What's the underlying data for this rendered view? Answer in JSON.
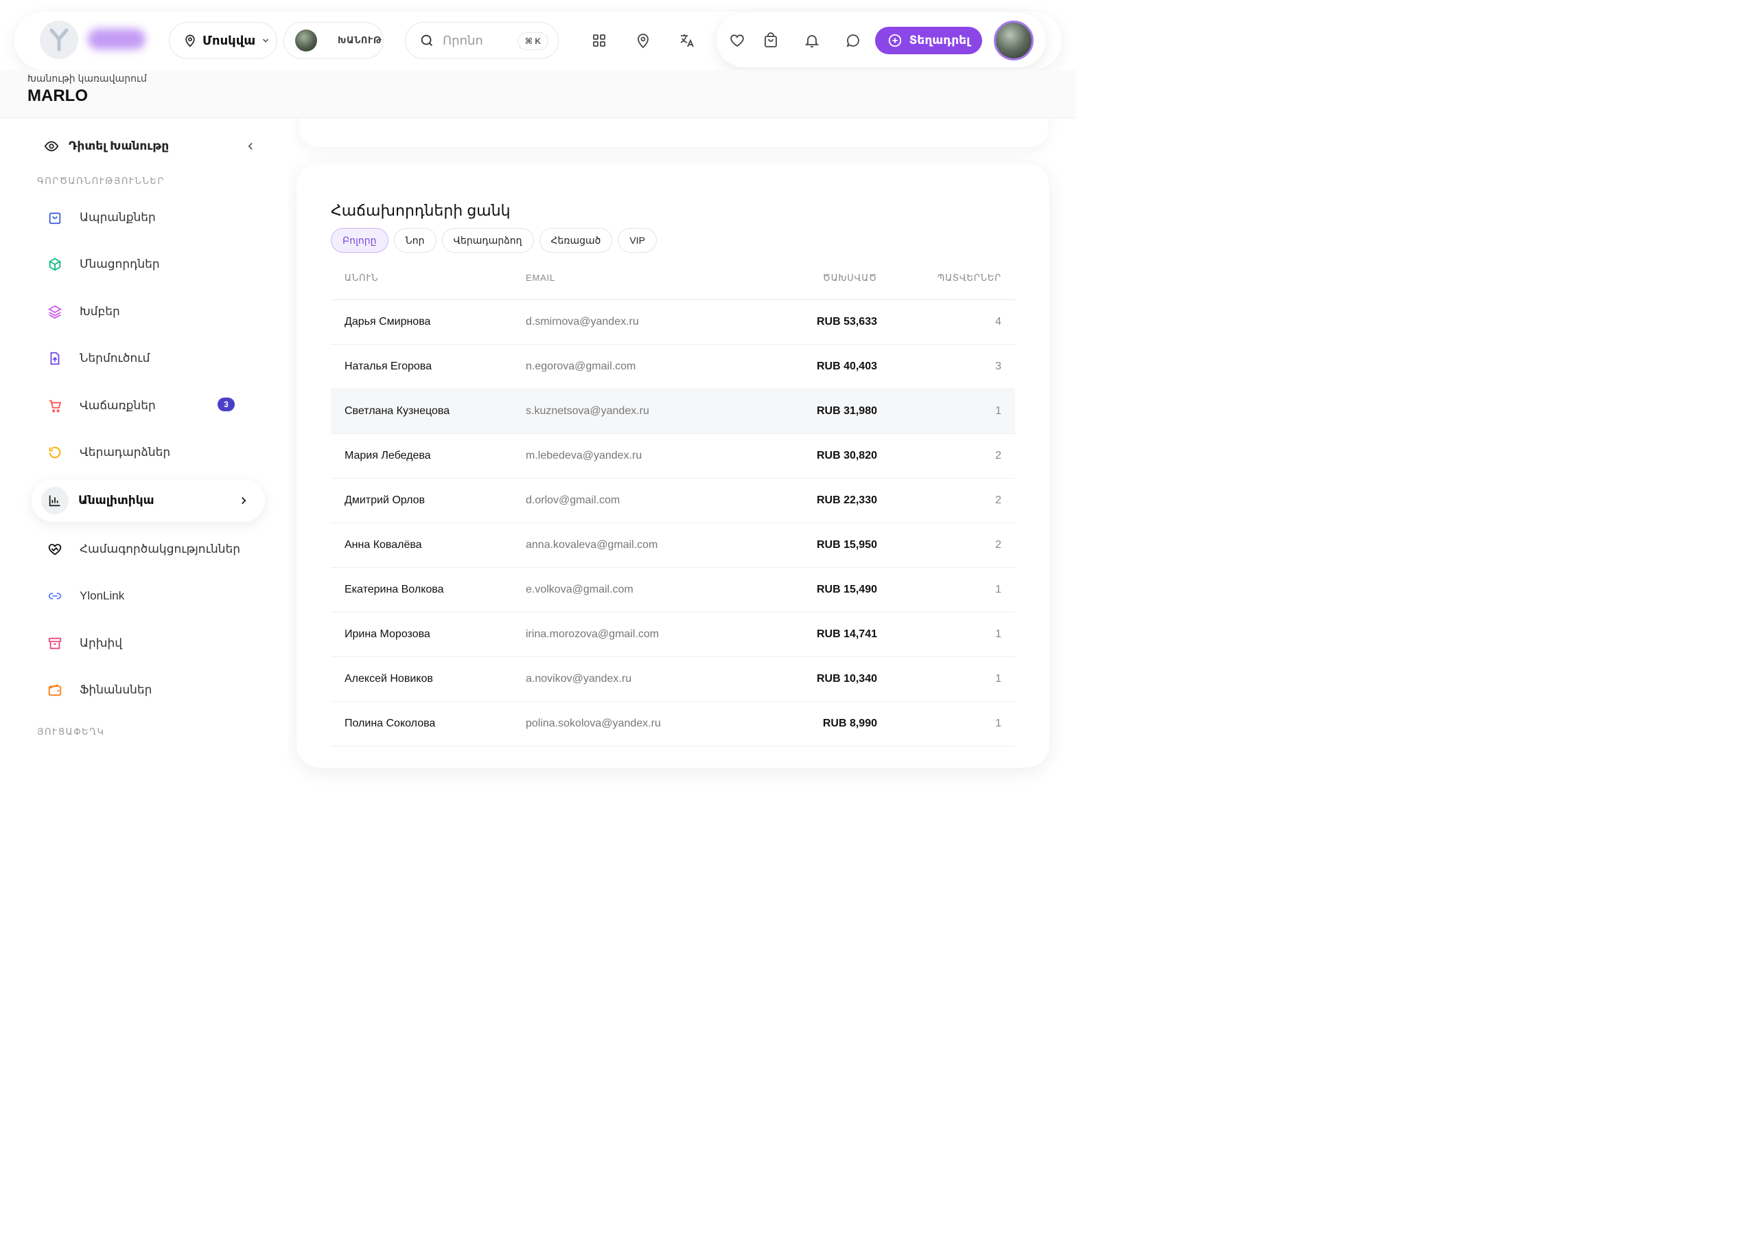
{
  "header": {
    "city": "Մոսկվա",
    "store_name": "ԽԱՆՈՒԹ",
    "search_placeholder": "Որոնո",
    "search_shortcut": "⌘ K",
    "post_button": "Տեղադրել"
  },
  "store": {
    "subtitle": "Խանութի կառավարում",
    "name": "MARLO"
  },
  "sidebar": {
    "view_store": "Դիտել Խանութը",
    "section_operations": "ԳՈՐԾԱՌՆՈՒԹՅՈՒՆՆԵՐ",
    "section_profile": "ՅՈՒՑԱՓԵՂԿ",
    "items": [
      {
        "label": "Ապրանքներ",
        "icon": "bag-icon",
        "color": "#3b5bdb"
      },
      {
        "label": "Մնացորդներ",
        "icon": "box-icon",
        "color": "#12b886"
      },
      {
        "label": "Խմբեր",
        "icon": "layers-icon",
        "color": "#cc5de8"
      },
      {
        "label": "Ներմուծում",
        "icon": "file-upload-icon",
        "color": "#7048e8"
      },
      {
        "label": "Վաճառքներ",
        "icon": "cart-icon",
        "color": "#fa5252",
        "badge": "3"
      },
      {
        "label": "Վերադարձներ",
        "icon": "refresh-icon",
        "color": "#fab005"
      },
      {
        "label": "Անալիտիկա",
        "icon": "chart-icon",
        "color": "#222222",
        "active": true
      },
      {
        "label": "Համագործակցություններ",
        "icon": "handshake-icon",
        "color": "#111111"
      },
      {
        "label": "YlonLink",
        "icon": "link-icon",
        "color": "#5c7cfa"
      },
      {
        "label": "Արխիվ",
        "icon": "archive-icon",
        "color": "#e64980"
      },
      {
        "label": "Ֆինանսներ",
        "icon": "wallet-icon",
        "color": "#fd7e14"
      }
    ]
  },
  "customers": {
    "title": "Հաճախորդների ցանկ",
    "filters": [
      "Բոլորը",
      "Նոր",
      "Վերադարձող",
      "Հեռացած",
      "VIP"
    ],
    "columns": [
      "ԱՆՈՒՆ",
      "EMAIL",
      "ԾԱԽՍՎԱԾ",
      "ՊԱՏՎԵՐՆԵՐ"
    ],
    "rows": [
      {
        "name": "Дарья Смирнова",
        "email": "d.smirnova@yandex.ru",
        "spent": "RUB 53,633",
        "orders": "4"
      },
      {
        "name": "Наталья Егорова",
        "email": "n.egorova@gmail.com",
        "spent": "RUB 40,403",
        "orders": "3"
      },
      {
        "name": "Светлана Кузнецова",
        "email": "s.kuznetsova@yandex.ru",
        "spent": "RUB 31,980",
        "orders": "1"
      },
      {
        "name": "Мария Лебедева",
        "email": "m.lebedeva@yandex.ru",
        "spent": "RUB 30,820",
        "orders": "2"
      },
      {
        "name": "Дмитрий Орлов",
        "email": "d.orlov@gmail.com",
        "spent": "RUB 22,330",
        "orders": "2"
      },
      {
        "name": "Анна Ковалёва",
        "email": "anna.kovaleva@gmail.com",
        "spent": "RUB 15,950",
        "orders": "2"
      },
      {
        "name": "Екатерина Волкова",
        "email": "e.volkova@gmail.com",
        "spent": "RUB 15,490",
        "orders": "1"
      },
      {
        "name": "Ирина Морозова",
        "email": "irina.morozova@gmail.com",
        "spent": "RUB 14,741",
        "orders": "1"
      },
      {
        "name": "Алексей Новиков",
        "email": "a.novikov@yandex.ru",
        "spent": "RUB 10,340",
        "orders": "1"
      },
      {
        "name": "Полина Соколова",
        "email": "polina.sokolova@yandex.ru",
        "spent": "RUB 8,990",
        "orders": "1"
      }
    ]
  }
}
